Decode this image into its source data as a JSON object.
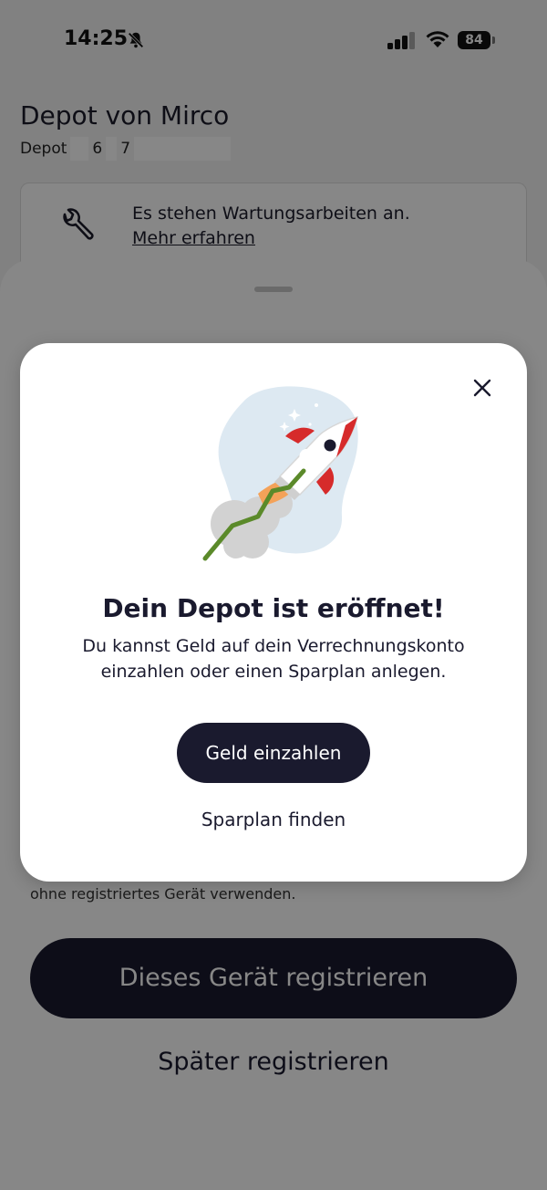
{
  "status_bar": {
    "time": "14:25",
    "battery": "84"
  },
  "page": {
    "title": "Depot von Mirco",
    "depot_label": "Depot",
    "depot_digits": [
      "6",
      "7"
    ]
  },
  "notice": {
    "text": "Es stehen Wartungsarbeiten an.",
    "link": "Mehr erfahren"
  },
  "sheet": {
    "caption": "ohne registriertes Gerät verwenden.",
    "primary_label": "Dieses Gerät registrieren",
    "secondary_label": "Später registrieren"
  },
  "modal": {
    "title": "Dein Depot ist eröffnet!",
    "text": "Du kannst Geld auf dein Verrechnungskonto einzahlen oder einen Sparplan anlegen.",
    "primary_label": "Geld einzahlen",
    "secondary_label": "Sparplan finden"
  },
  "colors": {
    "primary_button": "#1a1a2e",
    "overlay": "rgba(0,0,0,0.47)",
    "rocket_red": "#d62b2b",
    "trend_green": "#5b8a2a",
    "bubble_blue": "#dde9f2"
  },
  "icons": {
    "bell": "bell-slash-icon",
    "signal": "signal-icon",
    "wifi": "wifi-icon",
    "battery": "battery-icon",
    "wrench": "wrench-icon",
    "close": "close-icon",
    "illustration": "rocket-illustration"
  }
}
